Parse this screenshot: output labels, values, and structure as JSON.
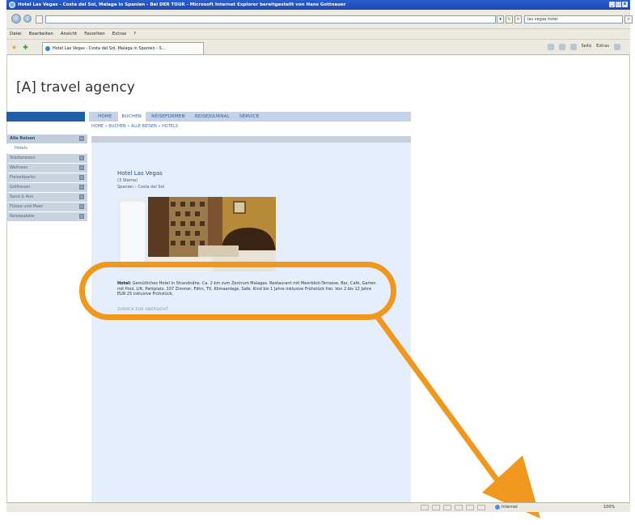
{
  "browser": {
    "window_title": "Hotel Las Vegas - Costa del Sol, Malaga in Spanien - Bei DER TOUR - Microsoft Internet Explorer bereitgestellt von Hans Gottnauer",
    "window_buttons": [
      "_",
      "□",
      "x"
    ],
    "address_url": "",
    "search_value": "las vegas hotel",
    "menu": [
      "Datei",
      "Bearbeiten",
      "Ansicht",
      "Favoriten",
      "Extras",
      "?"
    ],
    "tab_title": "Hotel Las Vegas - Costa del Sol, Malaga in Spanien - S...",
    "command_bar": [
      "Seite",
      "Extras"
    ]
  },
  "site": {
    "title": "[A] travel agency",
    "nav": [
      "HOME",
      "BUCHEN",
      "REISEFORMEN",
      "REISEJOURNAL",
      "SERVICE"
    ],
    "breadcrumb": "HOME » BUCHEN » ALLE REISEN » HOTELS"
  },
  "sidebar": {
    "items": [
      {
        "label": "Alle Reisen",
        "type": "head"
      },
      {
        "label": "Hotels",
        "type": "sub"
      },
      {
        "label": "Städtereisen",
        "type": "item"
      },
      {
        "label": "Wellness",
        "type": "item"
      },
      {
        "label": "Freizeitparks",
        "type": "item"
      },
      {
        "label": "Golfreisen",
        "type": "item"
      },
      {
        "label": "Sand & Ann",
        "type": "item"
      },
      {
        "label": "Flüsse und Meer",
        "type": "item"
      },
      {
        "label": "Reisepakete",
        "type": "item"
      }
    ]
  },
  "hotel": {
    "name": "Hotel Las Vegas",
    "stars": "(3 Sterne)",
    "location": "Spanien › Costa del Sol",
    "desc_label": "Hotel:",
    "description": "Gemütliches Hotel in Strandnähe. Ca. 2 km zum Zentrum Malagas. Restaurant mit Meerblick-Terrasse, Bar, Café, Garten mit Pool, Lift, Parkplatz. 107 Zimmer, Föhn, TV, Klimaanlage, Safe. Kind bis 1 Jahre inklusive Frühstück frei. Von 2 bis 12 Jahre EUR 25 inklusive Frühstück.",
    "link": "ZURÜCK ZUR ÜBERSICHT"
  },
  "statusbar": {
    "zone": "Internet",
    "zoom": "100%"
  },
  "colors": {
    "accent_orange": "#ef981d",
    "nav_blue": "#1f5fa8",
    "content_bg": "#e4eefc"
  }
}
